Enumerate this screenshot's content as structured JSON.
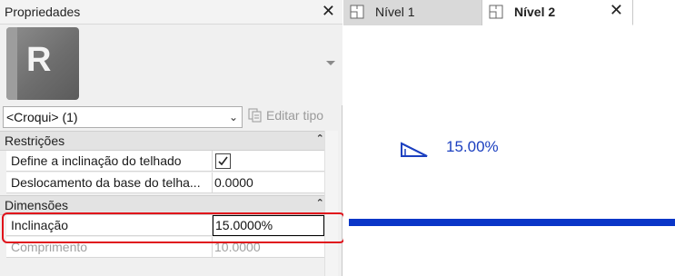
{
  "properties": {
    "title": "Propriedades",
    "type_selector": {
      "value": "<Croqui> (1)"
    },
    "edit_type_label": "Editar tipo",
    "sections": [
      {
        "name": "Restrições",
        "rows": [
          {
            "name": "Define a inclinação do telhado",
            "value": "",
            "checked": true
          },
          {
            "name": "Deslocamento da base do telha...",
            "value": "0.0000"
          }
        ]
      },
      {
        "name": "Dimensões",
        "rows": [
          {
            "name": "Inclinação",
            "value": "15.0000%"
          },
          {
            "name": "Comprimento",
            "value": "10.0000"
          }
        ]
      }
    ]
  },
  "tabs": [
    {
      "label": "Nível 1",
      "active": false
    },
    {
      "label": "Nível 2",
      "active": true
    }
  ],
  "canvas": {
    "slope_label": "15.00%"
  },
  "colors": {
    "accent_blue": "#0a36c8",
    "highlight_red": "#e0121b",
    "text_blue": "#1c40c0"
  }
}
